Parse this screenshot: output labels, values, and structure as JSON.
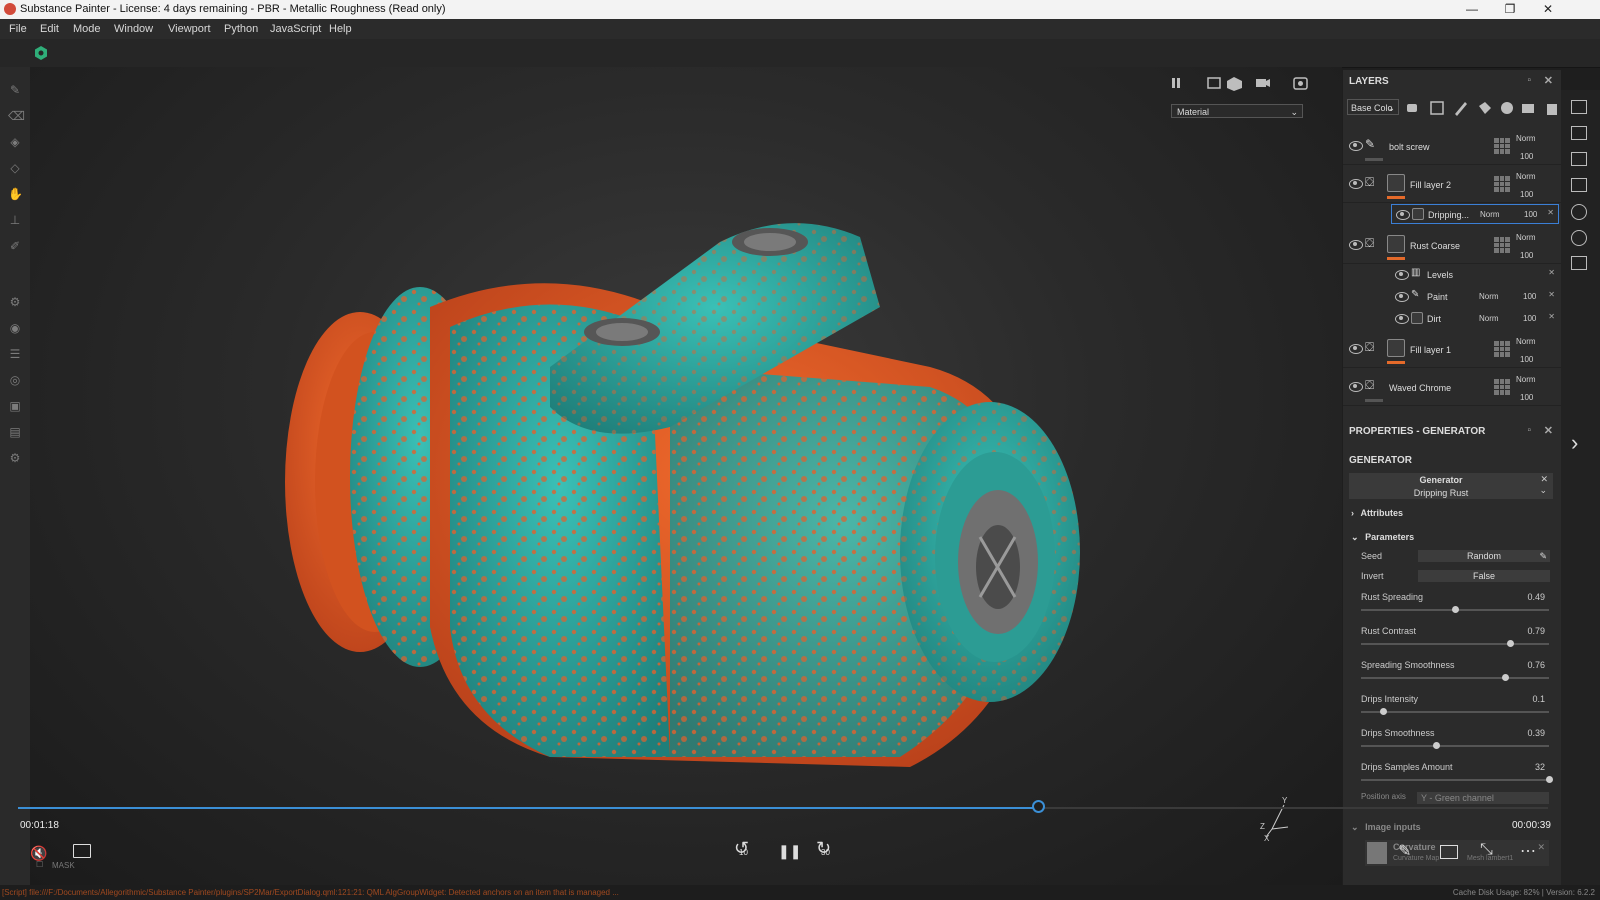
{
  "window": {
    "title": "Substance Painter - License: 4 days remaining - PBR - Metallic Roughness (Read only)",
    "controls": [
      "—",
      "❐",
      "✕"
    ]
  },
  "menu": [
    "File",
    "Edit",
    "Mode",
    "Window",
    "Viewport",
    "Python",
    "JavaScript",
    "Help"
  ],
  "viewport": {
    "channel_select": "Material"
  },
  "layers": {
    "title": "LAYERS",
    "channel": "Base Colo",
    "items": [
      {
        "name": "bolt screw",
        "blend": "Norm",
        "opacity": "100"
      },
      {
        "name": "Fill layer 2",
        "blend": "Norm",
        "opacity": "100"
      },
      {
        "name": "Dripping...",
        "blend": "Norm",
        "opacity": "100"
      },
      {
        "name": "Rust Coarse",
        "blend": "Norm",
        "opacity": "100"
      },
      {
        "name": "Levels"
      },
      {
        "name": "Paint",
        "blend": "Norm",
        "opacity": "100"
      },
      {
        "name": "Dirt",
        "blend": "Norm",
        "opacity": "100"
      },
      {
        "name": "Fill layer 1",
        "blend": "Norm",
        "opacity": "100"
      },
      {
        "name": "Waved Chrome",
        "blend": "Norm",
        "opacity": "100"
      }
    ]
  },
  "properties": {
    "title": "PROPERTIES - GENERATOR",
    "section": "GENERATOR",
    "generator_label": "Generator",
    "generator_name": "Dripping Rust",
    "attributes": "Attributes",
    "parameters": "Parameters",
    "seed_label": "Seed",
    "seed_value": "Random",
    "invert_label": "Invert",
    "invert_value": "False",
    "sliders": [
      {
        "label": "Rust Spreading",
        "value": 0.49
      },
      {
        "label": "Rust Contrast",
        "value": 0.79
      },
      {
        "label": "Spreading Smoothness",
        "value": 0.76
      },
      {
        "label": "Drips Intensity",
        "value": 0.1
      },
      {
        "label": "Drips Smoothness",
        "value": 0.39
      },
      {
        "label": "Drips Samples Amount",
        "value": 32,
        "max": 32
      }
    ],
    "position_axis_label": "Position axis",
    "position_axis_value": "Y - Green channel",
    "image_inputs": "Image inputs",
    "curvature": "Curvature",
    "curvature_map": "Curvature Map",
    "mesh": "Mesh lambert1"
  },
  "video": {
    "elapsed": "00:01:18",
    "remaining": "00:00:39",
    "progress": 0.667,
    "mask_label": "MASK",
    "skip_back": "10",
    "skip_forward": "30"
  },
  "status": {
    "message": "[Script] file:///F:/Documents/Allegorithmic/Substance Painter/plugins/SP2Mar/ExportDialog.qml:121:21: QML AlgGroupWidget: Detected anchors on an item that is managed ...",
    "right": "Cache Disk Usage: 82% | Version: 6.2.2"
  }
}
